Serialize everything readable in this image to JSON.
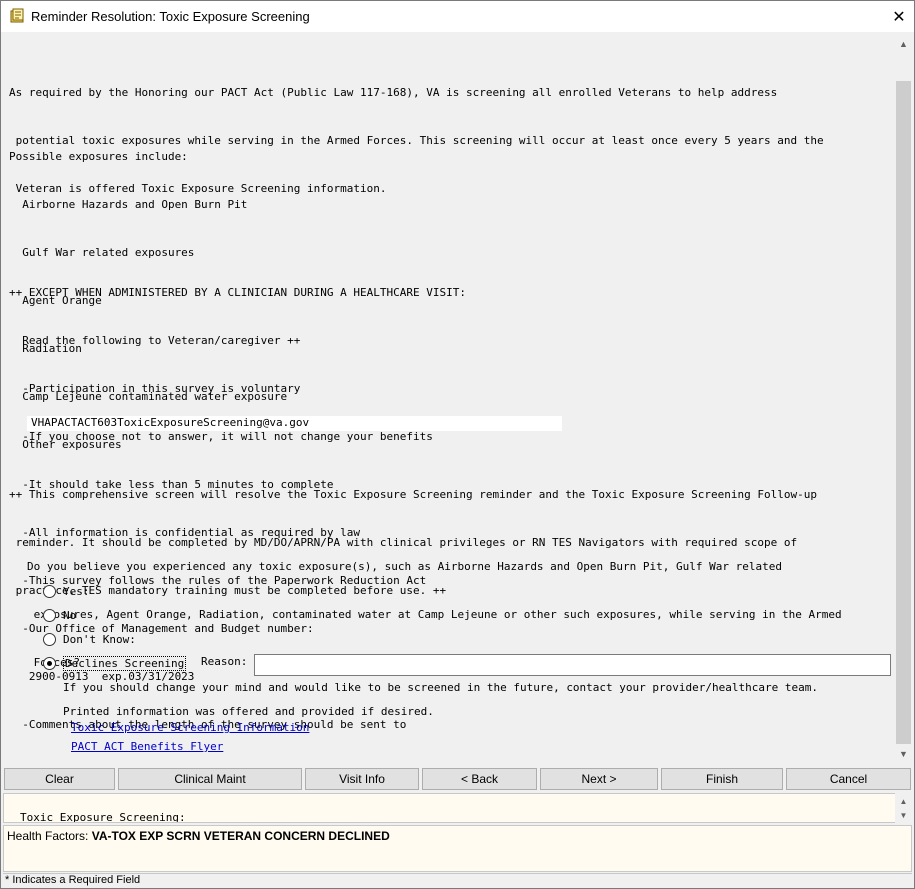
{
  "window": {
    "title": "Reminder Resolution: Toxic Exposure Screening",
    "close_glyph": "✕"
  },
  "intro": [
    "As required by the Honoring our PACT Act (Public Law 117-168), VA is screening all enrolled Veterans to help address",
    " potential toxic exposures while serving in the Armed Forces. This screening will occur at least once every 5 years and the",
    " Veteran is offered Toxic Exposure Screening information."
  ],
  "exposures_heading": "Possible exposures include:",
  "exposures": [
    "  Airborne Hazards and Open Burn Pit",
    "  Gulf War related exposures",
    "  Agent Orange",
    "  Radiation",
    "  Camp Lejeune contaminated water exposure",
    "  Other exposures"
  ],
  "read_block": [
    "++ EXCEPT WHEN ADMINISTERED BY A CLINICIAN DURING A HEALTHCARE VISIT:",
    "  Read the following to Veteran/caregiver ++",
    "  -Participation in this survey is voluntary",
    "  -If you choose not to answer, it will not change your benefits",
    "  -It should take less than 5 minutes to complete",
    "  -All information is confidential as required by law",
    "  -This survey follows the rules of the Paperwork Reduction Act",
    "  -Our Office of Management and Budget number:",
    "   2900-0913  exp.03/31/2023",
    "  -Comments about the length of the survey should be sent to"
  ],
  "email": "VHAPACTACT603ToxicExposureScreening@va.gov",
  "comprehensive": [
    "++ This comprehensive screen will resolve the Toxic Exposure Screening reminder and the Toxic Exposure Screening Follow-up",
    " reminder. It should be completed by MD/DO/APRN/PA with clinical privileges or RN TES Navigators with required scope of",
    " practice. TES mandatory training must be completed before use. ++"
  ],
  "question": [
    "Do you believe you experienced any toxic exposure(s), such as Airborne Hazards and Open Burn Pit, Gulf War related",
    " exposures, Agent Orange, Radiation, contaminated water at Camp Lejeune or other such exposures, while serving in the Armed",
    " Forces?"
  ],
  "options": {
    "yes": "Yes:",
    "no": "No",
    "dont_know": "Don't Know:",
    "declines": "Declines Screening"
  },
  "reason_label": "Reason:",
  "reason_value": "",
  "change_mind": "If you should change your mind and would like to be screened in the future, contact your provider/healthcare team.",
  "printed_info": "Printed information was offered and provided if desired.",
  "links": {
    "tes_info": "Toxic Exposure Screening Information",
    "pact_flyer": "PACT ACT Benefits Flyer"
  },
  "buttons": {
    "clear": "Clear",
    "clinical_maint": "Clinical Maint",
    "visit_info": "Visit Info",
    "back": "< Back",
    "next": "Next >",
    "finish": "Finish",
    "cancel": "Cancel"
  },
  "lower_text": "Toxic Exposure Screening:",
  "health_factors": {
    "label": "Health Factors: ",
    "value": "VA-TOX EXP SCRN VETERAN CONCERN DECLINED"
  },
  "status": "* Indicates a Required Field"
}
